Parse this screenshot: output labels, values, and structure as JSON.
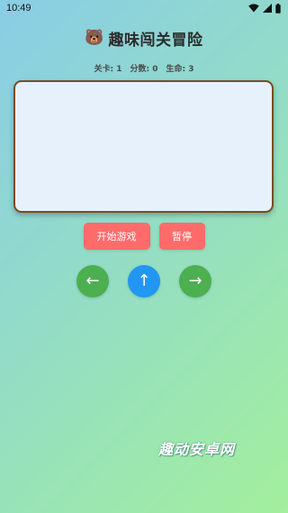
{
  "status_bar": {
    "time": "10:49",
    "icons": [
      "wifi-icon",
      "signal-icon",
      "battery-icon"
    ]
  },
  "header": {
    "icon": "bear-icon",
    "icon_glyph": "🐻",
    "title": "趣味闯关冒险"
  },
  "stats": {
    "level_label": "关卡:",
    "level_value": "1",
    "score_label": "分数:",
    "score_value": "0",
    "lives_label": "生命:",
    "lives_value": "3"
  },
  "buttons": {
    "start_label": "开始游戏",
    "pause_label": "暂停"
  },
  "controls": {
    "left_glyph": "←",
    "jump_glyph": "↑",
    "right_glyph": "→"
  },
  "watermark": {
    "text": "趣动安卓网"
  },
  "colors": {
    "game_canvas_bg": "#e6f1fb",
    "game_canvas_border": "#7d4a24",
    "action_button": "#ff6b6b",
    "move_button": "#4caf50",
    "jump_button": "#2196f3"
  }
}
